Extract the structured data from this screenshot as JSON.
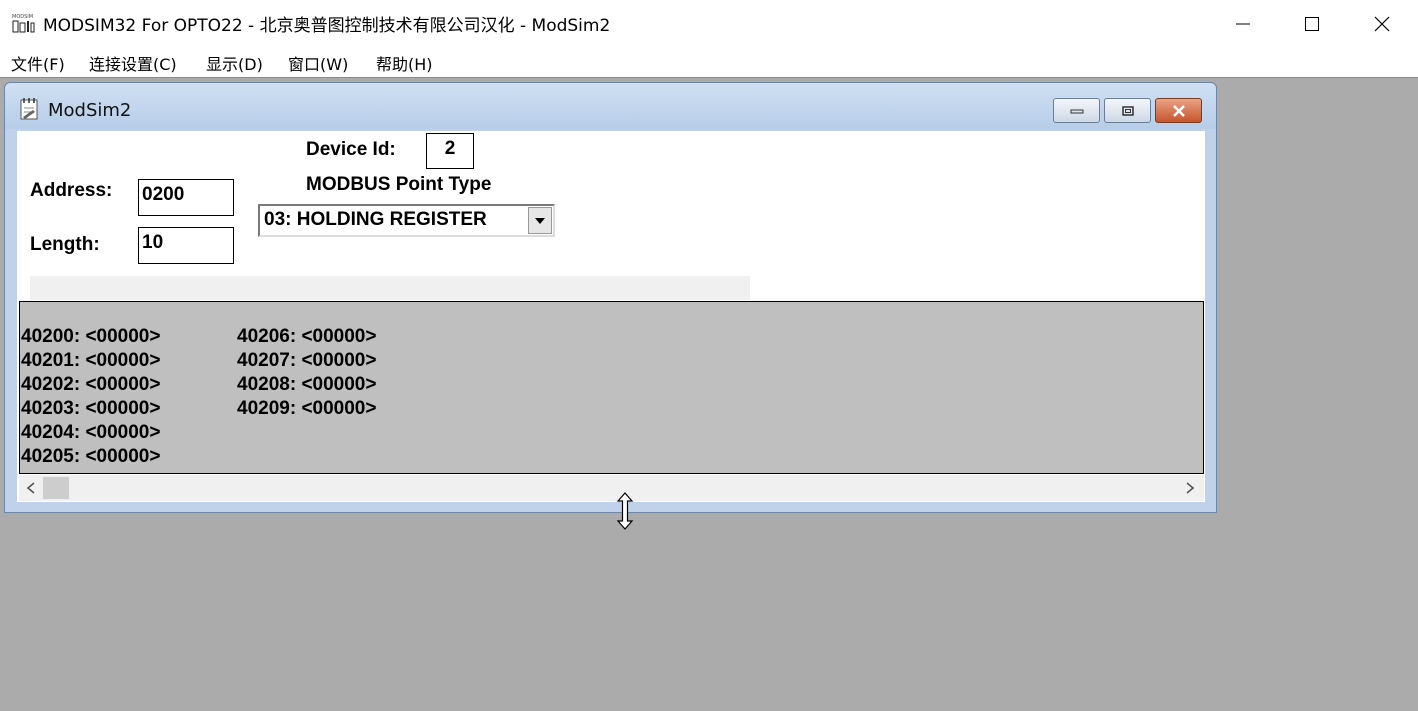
{
  "app": {
    "icon_text": "MODSIM",
    "title": "MODSIM32 For OPTO22 - 北京奥普图控制技术有限公司汉化 - ModSim2"
  },
  "menu": [
    "文件(F)",
    "连接设置(C)",
    "显示(D)",
    "窗口(W)",
    "帮助(H)"
  ],
  "child_window": {
    "title": "ModSim2"
  },
  "form": {
    "device_id_label": "Device Id:",
    "device_id_value": "2",
    "address_label": "Address:",
    "address_value": "0200",
    "point_type_label": "MODBUS Point Type",
    "point_type_value": "03: HOLDING REGISTER",
    "length_label": "Length:",
    "length_value": "10"
  },
  "registers": {
    "column1": [
      "40200: <00000>",
      "40201: <00000>",
      "40202: <00000>",
      "40203: <00000>",
      "40204: <00000>",
      "40205: <00000>"
    ],
    "column2": [
      "40206: <00000>",
      "40207: <00000>",
      "40208: <00000>",
      "40209: <00000>"
    ]
  },
  "colors": {
    "mdi_background": "#ababab",
    "grid_background": "#bfbfbf",
    "child_frame": "#bfd2ea",
    "close_button": "#c5552c"
  }
}
